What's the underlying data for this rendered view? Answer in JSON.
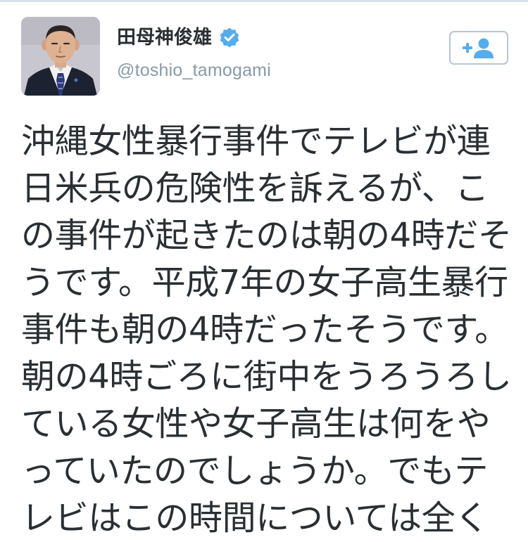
{
  "profile": {
    "display_name": "田母神俊雄",
    "username": "@toshio_tamogami",
    "verified_icon": "verified-badge-icon",
    "avatar_icon": "profile-photo"
  },
  "follow_button": {
    "icon": "follow-user-icon",
    "accent_color": "#55acee"
  },
  "tweet": {
    "lines": [
      "沖縄女性暴行事件でテレビが連",
      "日米兵の危険性を訴えるが、こ",
      "の事件が起きたのは朝の4時だそ",
      "うです。平成7年の女子高生暴行",
      "事件も朝の4時だったそうです。",
      "朝の4時ごろに街中をうろうろし",
      "ている女性や女子高生は何をや",
      "っていたのでしょうか。でもテ",
      "レビはこの時間については全く"
    ]
  },
  "colors": {
    "text": "#292f33",
    "secondary_text": "#8899a6",
    "verified_blue": "#55acee",
    "border": "#b7c5d0"
  }
}
